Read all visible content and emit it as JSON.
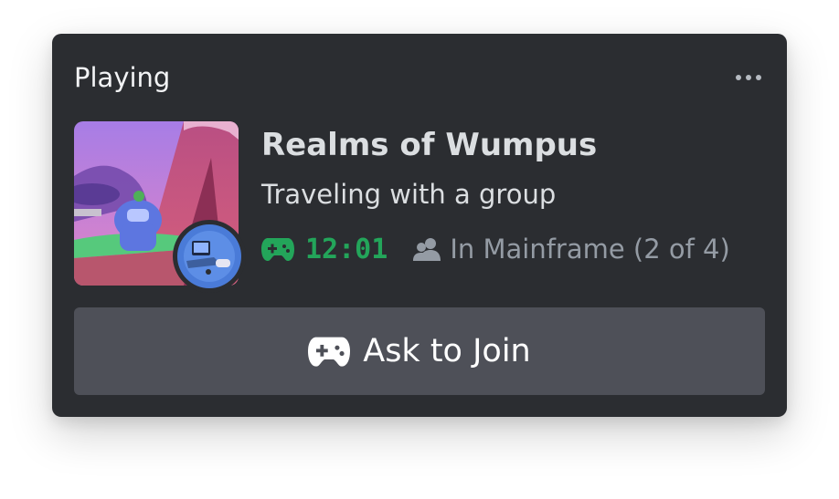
{
  "activity": {
    "header_label": "Playing",
    "more_icon": "more-horizontal-icon",
    "game_title": "Realms of Wumpus",
    "status": "Traveling with a group",
    "elapsed_time": "12:01",
    "party_text": "In Mainframe (2 of 4)",
    "join_label": "Ask to Join"
  },
  "colors": {
    "card_bg": "#2b2d31",
    "timer_green": "#23a55a",
    "button_bg": "#4e5058",
    "muted_text": "#949ba4"
  }
}
